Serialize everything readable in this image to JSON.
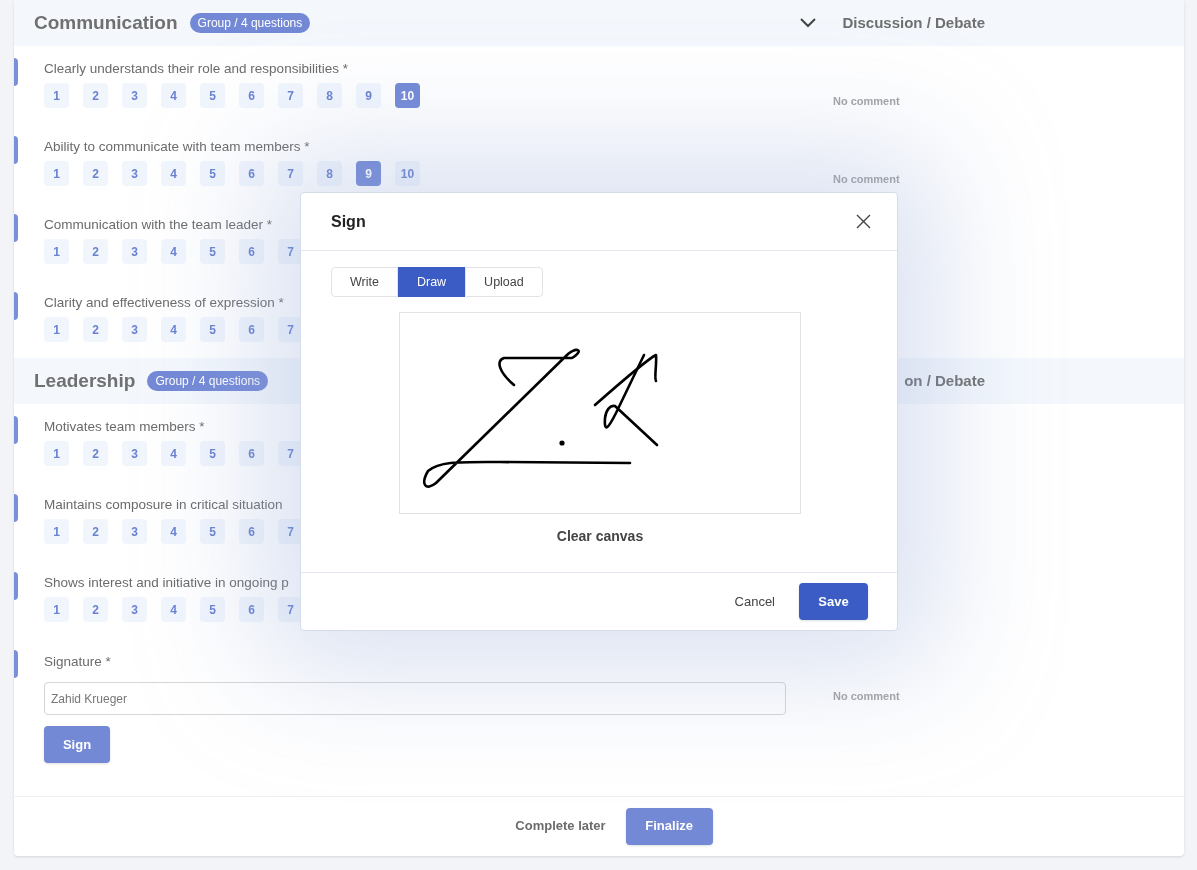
{
  "sections": [
    {
      "title": "Communication",
      "badge": "Group / 4 questions",
      "expanded": true,
      "discussion_header": "Discussion / Debate",
      "rows": [
        {
          "label": "Clearly understands their role and responsibilities *",
          "scores": [
            {
              "text": "1",
              "selected": false
            },
            {
              "text": "2",
              "selected": false
            },
            {
              "text": "3",
              "selected": false
            },
            {
              "text": "4",
              "selected": false
            },
            {
              "text": "5",
              "selected": false
            },
            {
              "text": "6",
              "selected": false
            },
            {
              "text": "7",
              "selected": false
            },
            {
              "text": "8",
              "selected": false
            },
            {
              "text": "9",
              "selected": false
            },
            {
              "text": "10",
              "selected": true
            }
          ],
          "comment": "No comment"
        },
        {
          "label": "Ability to communicate with team members *",
          "scores": [
            {
              "text": "1",
              "selected": false
            },
            {
              "text": "2",
              "selected": false
            },
            {
              "text": "3",
              "selected": false
            },
            {
              "text": "4",
              "selected": false
            },
            {
              "text": "5",
              "selected": false
            },
            {
              "text": "6",
              "selected": false
            },
            {
              "text": "7",
              "selected": false
            },
            {
              "text": "8",
              "selected": false
            },
            {
              "text": "9",
              "selected": true
            },
            {
              "text": "10",
              "selected": false
            }
          ],
          "comment": "No comment"
        },
        {
          "label": "Communication with the team leader *",
          "scores": [
            {
              "text": "1",
              "selected": false
            },
            {
              "text": "2",
              "selected": false
            },
            {
              "text": "3",
              "selected": false
            },
            {
              "text": "4",
              "selected": false
            },
            {
              "text": "5",
              "selected": false
            },
            {
              "text": "6",
              "selected": false
            },
            {
              "text": "7",
              "selected": false
            }
          ]
        },
        {
          "label": "Clarity and effectiveness of expression *",
          "scores": [
            {
              "text": "1",
              "selected": false
            },
            {
              "text": "2",
              "selected": false
            },
            {
              "text": "3",
              "selected": false
            },
            {
              "text": "4",
              "selected": false
            },
            {
              "text": "5",
              "selected": false
            },
            {
              "text": "6",
              "selected": false
            },
            {
              "text": "7",
              "selected": false
            }
          ]
        }
      ]
    },
    {
      "title": "Leadership",
      "badge": "Group / 4 questions",
      "discussion_header": "on / Debate",
      "rows": [
        {
          "label": "Motivates team members *",
          "scores": [
            {
              "text": "1",
              "selected": false
            },
            {
              "text": "2",
              "selected": false
            },
            {
              "text": "3",
              "selected": false
            },
            {
              "text": "4",
              "selected": false
            },
            {
              "text": "5",
              "selected": false
            },
            {
              "text": "6",
              "selected": false
            },
            {
              "text": "7",
              "selected": false
            }
          ]
        },
        {
          "label": "Maintains composure in critical situation",
          "scores": [
            {
              "text": "1",
              "selected": false
            },
            {
              "text": "2",
              "selected": false
            },
            {
              "text": "3",
              "selected": false
            },
            {
              "text": "4",
              "selected": false
            },
            {
              "text": "5",
              "selected": false
            },
            {
              "text": "6",
              "selected": false
            },
            {
              "text": "7",
              "selected": false
            }
          ]
        },
        {
          "label": "Shows interest and initiative in ongoing p",
          "scores": [
            {
              "text": "1",
              "selected": false
            },
            {
              "text": "2",
              "selected": false
            },
            {
              "text": "3",
              "selected": false
            },
            {
              "text": "4",
              "selected": false
            },
            {
              "text": "5",
              "selected": false
            },
            {
              "text": "6",
              "selected": false
            },
            {
              "text": "7",
              "selected": false
            }
          ]
        }
      ]
    }
  ],
  "signature": {
    "label": "Signature *",
    "value": "Zahid Krueger",
    "button": "Sign",
    "comment": "No comment"
  },
  "footer": {
    "secondary": "Complete later",
    "primary": "Finalize"
  },
  "dialog": {
    "title": "Sign",
    "tabs": [
      {
        "label": "Write",
        "selected": false
      },
      {
        "label": "Draw",
        "selected": true
      },
      {
        "label": "Upload",
        "selected": false
      }
    ],
    "clear": "Clear canvas",
    "cancel": "Cancel",
    "save": "Save"
  }
}
